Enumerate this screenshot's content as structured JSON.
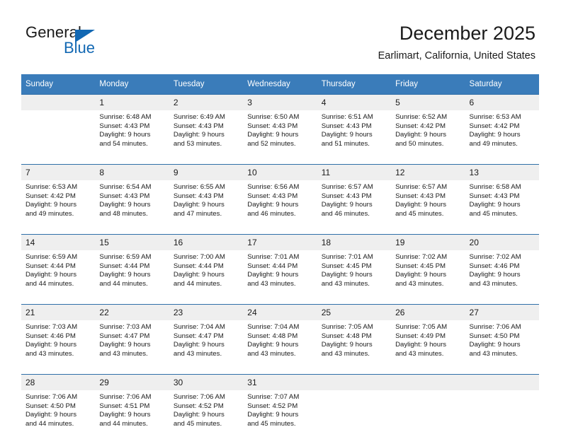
{
  "brand": {
    "name_part1": "General",
    "name_part2": "Blue",
    "logo_icon": "blue-triangle-icon",
    "accent_color": "#1268b3"
  },
  "header": {
    "title": "December 2025",
    "subtitle": "Earlimart, California, United States"
  },
  "theme": {
    "header_bar_color": "#3a7cba",
    "daynum_band_color": "#efefef",
    "row_separator_color": "#2f6fa8",
    "text_color": "#1a1a1a"
  },
  "weekday_headers": [
    "Sunday",
    "Monday",
    "Tuesday",
    "Wednesday",
    "Thursday",
    "Friday",
    "Saturday"
  ],
  "weeks": [
    {
      "days": [
        {
          "num": "",
          "sunrise": "",
          "sunset": "",
          "daylight_line1": "",
          "daylight_line2": "",
          "empty": true
        },
        {
          "num": "1",
          "sunrise": "Sunrise: 6:48 AM",
          "sunset": "Sunset: 4:43 PM",
          "daylight_line1": "Daylight: 9 hours",
          "daylight_line2": "and 54 minutes.",
          "empty": false
        },
        {
          "num": "2",
          "sunrise": "Sunrise: 6:49 AM",
          "sunset": "Sunset: 4:43 PM",
          "daylight_line1": "Daylight: 9 hours",
          "daylight_line2": "and 53 minutes.",
          "empty": false
        },
        {
          "num": "3",
          "sunrise": "Sunrise: 6:50 AM",
          "sunset": "Sunset: 4:43 PM",
          "daylight_line1": "Daylight: 9 hours",
          "daylight_line2": "and 52 minutes.",
          "empty": false
        },
        {
          "num": "4",
          "sunrise": "Sunrise: 6:51 AM",
          "sunset": "Sunset: 4:43 PM",
          "daylight_line1": "Daylight: 9 hours",
          "daylight_line2": "and 51 minutes.",
          "empty": false
        },
        {
          "num": "5",
          "sunrise": "Sunrise: 6:52 AM",
          "sunset": "Sunset: 4:42 PM",
          "daylight_line1": "Daylight: 9 hours",
          "daylight_line2": "and 50 minutes.",
          "empty": false
        },
        {
          "num": "6",
          "sunrise": "Sunrise: 6:53 AM",
          "sunset": "Sunset: 4:42 PM",
          "daylight_line1": "Daylight: 9 hours",
          "daylight_line2": "and 49 minutes.",
          "empty": false
        }
      ]
    },
    {
      "days": [
        {
          "num": "7",
          "sunrise": "Sunrise: 6:53 AM",
          "sunset": "Sunset: 4:42 PM",
          "daylight_line1": "Daylight: 9 hours",
          "daylight_line2": "and 49 minutes.",
          "empty": false
        },
        {
          "num": "8",
          "sunrise": "Sunrise: 6:54 AM",
          "sunset": "Sunset: 4:43 PM",
          "daylight_line1": "Daylight: 9 hours",
          "daylight_line2": "and 48 minutes.",
          "empty": false
        },
        {
          "num": "9",
          "sunrise": "Sunrise: 6:55 AM",
          "sunset": "Sunset: 4:43 PM",
          "daylight_line1": "Daylight: 9 hours",
          "daylight_line2": "and 47 minutes.",
          "empty": false
        },
        {
          "num": "10",
          "sunrise": "Sunrise: 6:56 AM",
          "sunset": "Sunset: 4:43 PM",
          "daylight_line1": "Daylight: 9 hours",
          "daylight_line2": "and 46 minutes.",
          "empty": false
        },
        {
          "num": "11",
          "sunrise": "Sunrise: 6:57 AM",
          "sunset": "Sunset: 4:43 PM",
          "daylight_line1": "Daylight: 9 hours",
          "daylight_line2": "and 46 minutes.",
          "empty": false
        },
        {
          "num": "12",
          "sunrise": "Sunrise: 6:57 AM",
          "sunset": "Sunset: 4:43 PM",
          "daylight_line1": "Daylight: 9 hours",
          "daylight_line2": "and 45 minutes.",
          "empty": false
        },
        {
          "num": "13",
          "sunrise": "Sunrise: 6:58 AM",
          "sunset": "Sunset: 4:43 PM",
          "daylight_line1": "Daylight: 9 hours",
          "daylight_line2": "and 45 minutes.",
          "empty": false
        }
      ]
    },
    {
      "days": [
        {
          "num": "14",
          "sunrise": "Sunrise: 6:59 AM",
          "sunset": "Sunset: 4:44 PM",
          "daylight_line1": "Daylight: 9 hours",
          "daylight_line2": "and 44 minutes.",
          "empty": false
        },
        {
          "num": "15",
          "sunrise": "Sunrise: 6:59 AM",
          "sunset": "Sunset: 4:44 PM",
          "daylight_line1": "Daylight: 9 hours",
          "daylight_line2": "and 44 minutes.",
          "empty": false
        },
        {
          "num": "16",
          "sunrise": "Sunrise: 7:00 AM",
          "sunset": "Sunset: 4:44 PM",
          "daylight_line1": "Daylight: 9 hours",
          "daylight_line2": "and 44 minutes.",
          "empty": false
        },
        {
          "num": "17",
          "sunrise": "Sunrise: 7:01 AM",
          "sunset": "Sunset: 4:44 PM",
          "daylight_line1": "Daylight: 9 hours",
          "daylight_line2": "and 43 minutes.",
          "empty": false
        },
        {
          "num": "18",
          "sunrise": "Sunrise: 7:01 AM",
          "sunset": "Sunset: 4:45 PM",
          "daylight_line1": "Daylight: 9 hours",
          "daylight_line2": "and 43 minutes.",
          "empty": false
        },
        {
          "num": "19",
          "sunrise": "Sunrise: 7:02 AM",
          "sunset": "Sunset: 4:45 PM",
          "daylight_line1": "Daylight: 9 hours",
          "daylight_line2": "and 43 minutes.",
          "empty": false
        },
        {
          "num": "20",
          "sunrise": "Sunrise: 7:02 AM",
          "sunset": "Sunset: 4:46 PM",
          "daylight_line1": "Daylight: 9 hours",
          "daylight_line2": "and 43 minutes.",
          "empty": false
        }
      ]
    },
    {
      "days": [
        {
          "num": "21",
          "sunrise": "Sunrise: 7:03 AM",
          "sunset": "Sunset: 4:46 PM",
          "daylight_line1": "Daylight: 9 hours",
          "daylight_line2": "and 43 minutes.",
          "empty": false
        },
        {
          "num": "22",
          "sunrise": "Sunrise: 7:03 AM",
          "sunset": "Sunset: 4:47 PM",
          "daylight_line1": "Daylight: 9 hours",
          "daylight_line2": "and 43 minutes.",
          "empty": false
        },
        {
          "num": "23",
          "sunrise": "Sunrise: 7:04 AM",
          "sunset": "Sunset: 4:47 PM",
          "daylight_line1": "Daylight: 9 hours",
          "daylight_line2": "and 43 minutes.",
          "empty": false
        },
        {
          "num": "24",
          "sunrise": "Sunrise: 7:04 AM",
          "sunset": "Sunset: 4:48 PM",
          "daylight_line1": "Daylight: 9 hours",
          "daylight_line2": "and 43 minutes.",
          "empty": false
        },
        {
          "num": "25",
          "sunrise": "Sunrise: 7:05 AM",
          "sunset": "Sunset: 4:48 PM",
          "daylight_line1": "Daylight: 9 hours",
          "daylight_line2": "and 43 minutes.",
          "empty": false
        },
        {
          "num": "26",
          "sunrise": "Sunrise: 7:05 AM",
          "sunset": "Sunset: 4:49 PM",
          "daylight_line1": "Daylight: 9 hours",
          "daylight_line2": "and 43 minutes.",
          "empty": false
        },
        {
          "num": "27",
          "sunrise": "Sunrise: 7:06 AM",
          "sunset": "Sunset: 4:50 PM",
          "daylight_line1": "Daylight: 9 hours",
          "daylight_line2": "and 43 minutes.",
          "empty": false
        }
      ]
    },
    {
      "days": [
        {
          "num": "28",
          "sunrise": "Sunrise: 7:06 AM",
          "sunset": "Sunset: 4:50 PM",
          "daylight_line1": "Daylight: 9 hours",
          "daylight_line2": "and 44 minutes.",
          "empty": false
        },
        {
          "num": "29",
          "sunrise": "Sunrise: 7:06 AM",
          "sunset": "Sunset: 4:51 PM",
          "daylight_line1": "Daylight: 9 hours",
          "daylight_line2": "and 44 minutes.",
          "empty": false
        },
        {
          "num": "30",
          "sunrise": "Sunrise: 7:06 AM",
          "sunset": "Sunset: 4:52 PM",
          "daylight_line1": "Daylight: 9 hours",
          "daylight_line2": "and 45 minutes.",
          "empty": false
        },
        {
          "num": "31",
          "sunrise": "Sunrise: 7:07 AM",
          "sunset": "Sunset: 4:52 PM",
          "daylight_line1": "Daylight: 9 hours",
          "daylight_line2": "and 45 minutes.",
          "empty": false
        },
        {
          "num": "",
          "sunrise": "",
          "sunset": "",
          "daylight_line1": "",
          "daylight_line2": "",
          "empty": true
        },
        {
          "num": "",
          "sunrise": "",
          "sunset": "",
          "daylight_line1": "",
          "daylight_line2": "",
          "empty": true
        },
        {
          "num": "",
          "sunrise": "",
          "sunset": "",
          "daylight_line1": "",
          "daylight_line2": "",
          "empty": true
        }
      ]
    }
  ]
}
